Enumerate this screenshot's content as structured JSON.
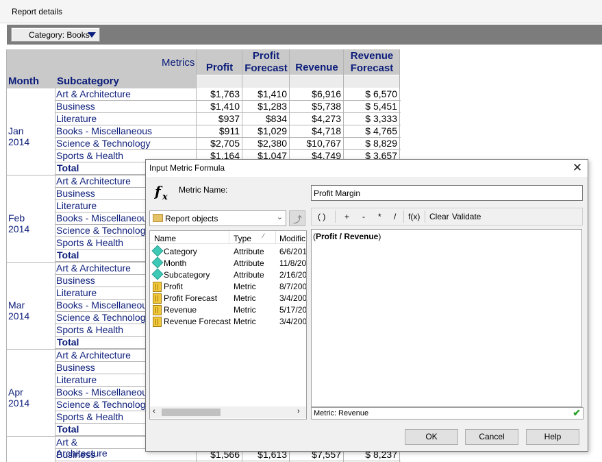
{
  "topbar": {
    "title": "Report details"
  },
  "category_button": {
    "label": "Category: Books"
  },
  "grid": {
    "metrics_label": "Metrics",
    "month_header": "Month",
    "subcategory_header": "Subcategory",
    "columns": [
      "Profit",
      "Profit Forecast",
      "Revenue",
      "Revenue Forecast"
    ],
    "months": [
      "Jan 2014",
      "Feb 2014",
      "Mar 2014",
      "Apr 2014"
    ],
    "subcategories": [
      "Art & Architecture",
      "Business",
      "Literature",
      "Books - Miscellaneous",
      "Science & Technology",
      "Sports & Health"
    ],
    "total_label": "Total",
    "jan_rows": [
      [
        "$1,763",
        "$1,410",
        "$6,916",
        "$ 6,570"
      ],
      [
        "$1,410",
        "$1,283",
        "$5,738",
        "$ 5,451"
      ],
      [
        "$937",
        "$834",
        "$4,273",
        "$ 3,333"
      ],
      [
        "$911",
        "$1,029",
        "$4,718",
        "$ 4,765"
      ],
      [
        "$2,705",
        "$2,380",
        "$10,767",
        "$ 8,829"
      ],
      [
        "$1,164",
        "$1,047",
        "$4,749",
        "$ 3,657"
      ]
    ],
    "last_row": [
      "$1,566",
      "$1,613",
      "$7,557",
      "$ 8,237"
    ]
  },
  "dialog": {
    "title": "Input Metric Formula",
    "fx_icon": "fx-icon",
    "metric_name_label": "Metric Name:",
    "metric_name_value": "Profit Margin",
    "objects_dropdown": "Report objects",
    "toolbar": [
      "( )",
      "+",
      "-",
      "*",
      "/",
      "f(x)",
      "Clear",
      "Validate"
    ],
    "list_headers": [
      "Name",
      "Type",
      "Modific"
    ],
    "list_items": [
      {
        "name": "Category",
        "type": "Attribute",
        "modified": "6/6/201",
        "icon": "attribute-icon"
      },
      {
        "name": "Month",
        "type": "Attribute",
        "modified": "11/8/20",
        "icon": "attribute-icon"
      },
      {
        "name": "Subcategory",
        "type": "Attribute",
        "modified": "2/16/20",
        "icon": "attribute-icon"
      },
      {
        "name": "Profit",
        "type": "Metric",
        "modified": "8/7/200",
        "icon": "metric-icon"
      },
      {
        "name": "Profit Forecast",
        "type": "Metric",
        "modified": "3/4/200",
        "icon": "metric-icon"
      },
      {
        "name": "Revenue",
        "type": "Metric",
        "modified": "5/17/20",
        "icon": "metric-icon"
      },
      {
        "name": "Revenue Forecast",
        "type": "Metric",
        "modified": "3/4/200",
        "icon": "metric-icon"
      }
    ],
    "formula_open": "(",
    "formula_body": "Profit / Revenue",
    "formula_close": ")",
    "status": "Metric: Revenue",
    "buttons": {
      "ok": "OK",
      "cancel": "Cancel",
      "help": "Help"
    }
  }
}
